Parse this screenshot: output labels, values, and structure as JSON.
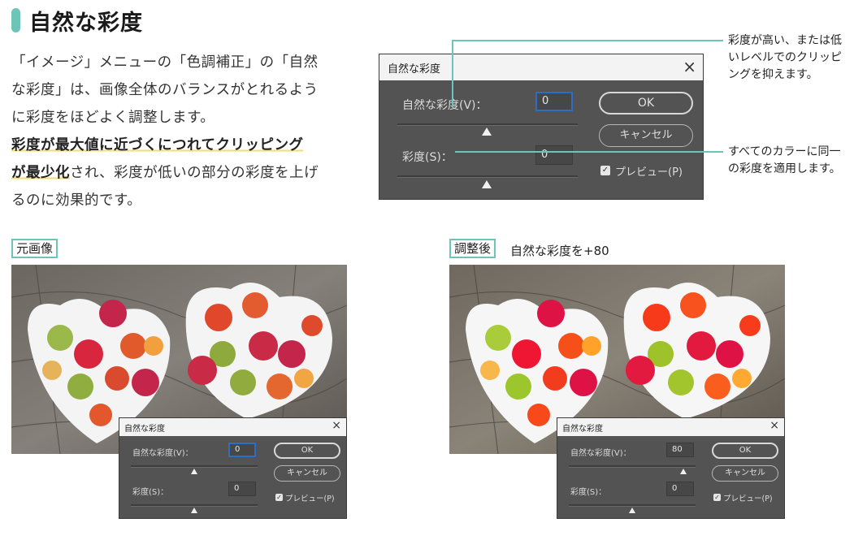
{
  "heading": "自然な彩度",
  "intro_lines": [
    "「イメージ」メニューの「色調補正」の「自然",
    "な彩度」は、画像全体のバランスがとれるよう",
    "に彩度をほどよく調整します。"
  ],
  "emphasis_line1": "彩度が最大値に近づくにつれてクリッピング",
  "emphasis_line2_bold": "が最少化",
  "emphasis_line2_rest": "され、彩度が低いの部分の彩度を上げ",
  "last_line": "るのに効果的です。",
  "main_dialog": {
    "title": "自然な彩度",
    "vibrance_label": "自然な彩度(V)：",
    "vibrance_value": "0",
    "saturation_label": "彩度(S)：",
    "saturation_value": "0",
    "ok": "OK",
    "cancel": "キャンセル",
    "preview": "プレビュー(P)",
    "close": "×"
  },
  "callout_top": [
    "彩度が高い、または低",
    "いレベルでのクリッピ",
    "ングを抑えます。"
  ],
  "callout_bottom": [
    "すべてのカラーに同一",
    "の彩度を適用します。"
  ],
  "left_tag": "元画像",
  "right_tag": "調整後",
  "right_caption": "自然な彩度を+80",
  "small_dialog_left": {
    "title": "自然な彩度",
    "vibrance_label": "自然な彩度(V)：",
    "vibrance_value": "0",
    "saturation_label": "彩度(S)：",
    "saturation_value": "0",
    "ok": "OK",
    "cancel": "キャンセル",
    "preview": "プレビュー(P)",
    "close": "×"
  },
  "small_dialog_right": {
    "title": "自然な彩度",
    "vibrance_label": "自然な彩度(V)：",
    "vibrance_value": "80",
    "saturation_label": "彩度(S)：",
    "saturation_value": "0",
    "ok": "OK",
    "cancel": "キャンセル",
    "preview": "プレビュー(P)",
    "close": "×"
  },
  "colors": {
    "accent": "#6dc5b9",
    "highlight": "#f3df6a",
    "dialog_bg": "#535353",
    "focus": "#2b6fc5"
  }
}
